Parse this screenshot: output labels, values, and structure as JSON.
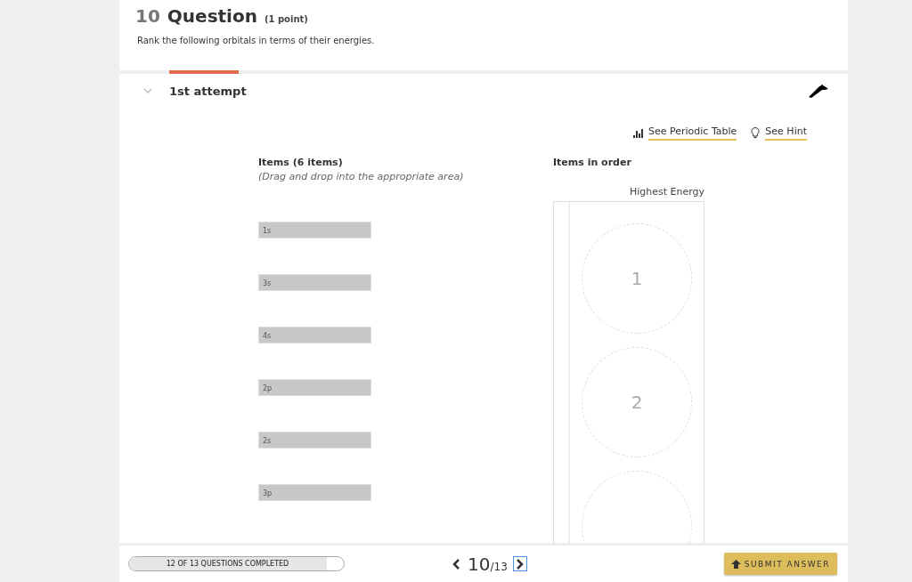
{
  "question": {
    "number": "10",
    "title": "Question",
    "points": "(1 point)",
    "prompt": "Rank the following orbitals in terms of their energies."
  },
  "attempt": {
    "label": "1st attempt",
    "expanded": true
  },
  "links": [
    {
      "kind": "periodic",
      "label": "See Periodic Table"
    },
    {
      "kind": "hint",
      "label": "See Hint"
    }
  ],
  "items": {
    "heading": "Items (6 items)",
    "instruction": "(Drag and drop into the appropriate area)",
    "list": [
      "1s",
      "3s",
      "4s",
      "2p",
      "2s",
      "3p"
    ]
  },
  "order": {
    "heading": "Items in order",
    "top_label": "Highest Energy",
    "slots": [
      "1",
      "2"
    ]
  },
  "footer": {
    "progress": {
      "label": "12 OF 13 QUESTIONS COMPLETED",
      "level": 0.92
    },
    "page_current": "10",
    "page_total": "/13",
    "submit": "SUBMIT ANSWER"
  }
}
